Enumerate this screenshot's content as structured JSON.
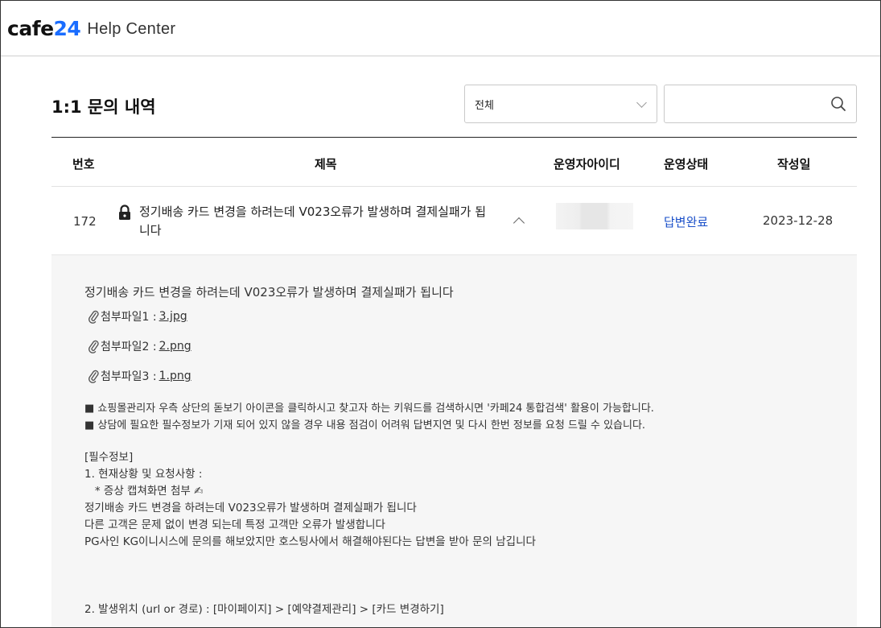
{
  "header": {
    "logo_text": "cafe",
    "logo_num": "24",
    "help_title": "Help Center"
  },
  "page": {
    "title": "1:1 문의 내역",
    "filter_value": "전체",
    "search_placeholder": ""
  },
  "table": {
    "columns": {
      "no": "번호",
      "subject": "제목",
      "operator": "운영자아이디",
      "status": "운영상태",
      "date": "작성일"
    },
    "row": {
      "no": "172",
      "subject": "정기배송 카드 변경을 하려는데 V023오류가 발생하며 결제실패가 됩니다",
      "status": "답변완료",
      "date": "2023-12-28"
    }
  },
  "detail": {
    "title": "정기배송 카드 변경을 하려는데 V023오류가 발생하며 결제실패가 됩니다",
    "attachments": [
      {
        "label": "첨부파일1 :",
        "file": "3.jpg"
      },
      {
        "label": "첨부파일2 :",
        "file": "2.png"
      },
      {
        "label": "첨부파일3 :",
        "file": "1.png"
      }
    ],
    "notice1": "■ 쇼핑몰관리자 우측 상단의 돋보기 아이콘을 클릭하시고 찾고자 하는 키워드를 검색하시면 '카페24 통합검색' 활용이 가능합니다.",
    "notice2": "■ 상담에 필요한 필수정보가 기재 되어 있지 않을 경우 내용 점검이 어려워 답변지연 및 다시 한번 정보를 요청 드릴 수 있습니다.",
    "body": "[필수정보]\n1. 현재상황 및 요청사항 :\n   * 증상 캡쳐화면 첨부 ✍\n정기배송 카드 변경을 하려는데 V023오류가 발생하며 결제실패가 됩니다\n다른 고객은 문제 없이 변경 되는데 특정 고객만 오류가 발생합니다\nPG사인 KG이니시스에 문의를 해보았지만 호스팅사에서 해결해야된다는 답변을 받아 문의 남깁니다",
    "location": "2. 발생위치 (url or 경로) : [마이페이지] > [예약결제관리] > [카드 변경하기]"
  }
}
